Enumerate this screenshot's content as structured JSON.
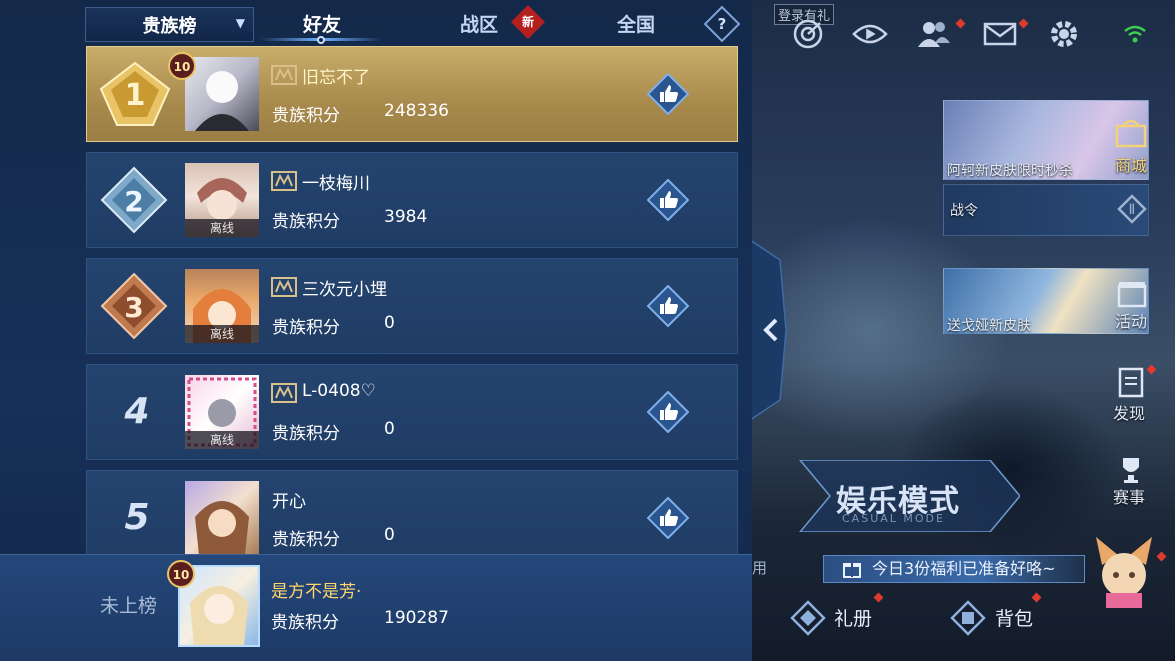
{
  "leaderboard": {
    "category_dropdown": "贵族榜",
    "tabs": [
      {
        "label": "好友",
        "active": true
      },
      {
        "label": "战区",
        "badge": "新"
      },
      {
        "label": "全国"
      }
    ],
    "help": "?",
    "score_label": "贵族积分",
    "offline_label": "离线",
    "rows": [
      {
        "rank": "1",
        "name": "旧忘不了",
        "score": "248336",
        "level": "10"
      },
      {
        "rank": "2",
        "name": "一枝梅川",
        "score": "3984"
      },
      {
        "rank": "3",
        "name": "三次元小埋",
        "score": "0"
      },
      {
        "rank": "4",
        "name": "L-0408♡",
        "score": "0"
      },
      {
        "rank": "5",
        "name": "开心",
        "score": "0"
      }
    ],
    "self": {
      "rank_label": "未上榜",
      "name": "是方不是芳·",
      "score": "190287",
      "level": "10"
    }
  },
  "game": {
    "login_gift": "登录有礼",
    "promo_skin": "阿轲新皮肤限时秒杀",
    "shop": "商城",
    "battle_pass": "战令",
    "promo_gift": "送戈娅新皮肤",
    "activity": "活动",
    "discover": "发现",
    "events": "赛事",
    "mode_title": "娱乐模式",
    "mode_sub": "CASUAL MODE",
    "welfare": "今日3份福利已准备好咯~",
    "partial": "用",
    "gift_book": "礼册",
    "backpack": "背包"
  },
  "colors": {
    "accent_gold": "#c9ad6a",
    "self_name": "#ffd66b",
    "notify_red": "#e03a2e"
  }
}
